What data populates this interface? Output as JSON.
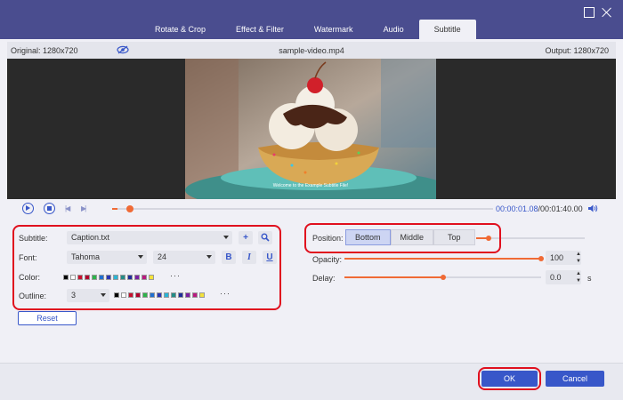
{
  "tabs": [
    {
      "label": "Rotate & Crop"
    },
    {
      "label": "Effect & Filter"
    },
    {
      "label": "Watermark"
    },
    {
      "label": "Audio"
    },
    {
      "label": "Subtitle"
    }
  ],
  "active_tab": "Subtitle",
  "info": {
    "original": "Original: 1280x720",
    "filename": "sample-video.mp4",
    "output": "Output: 1280x720"
  },
  "preview": {
    "subtitle_text": "Welcome to the Example Subtitle File!"
  },
  "playback": {
    "current_time": "00:00:01.08",
    "total_time": "/00:01:40.00",
    "progress": 0.015
  },
  "subtitle_form": {
    "subtitle_label": "Subtitle:",
    "subtitle_file": "Caption.txt",
    "font_label": "Font:",
    "font_name": "Tahoma",
    "font_size": "24",
    "bold": "B",
    "italic": "I",
    "underline": "U",
    "color_label": "Color:",
    "outline_label": "Outline:",
    "outline_value": "3",
    "more": "···",
    "reset": "Reset"
  },
  "palette": [
    "#000000",
    "#ffffff",
    "#c8102e",
    "#b3002d",
    "#2cb44a",
    "#1f6fd1",
    "#2a35b5",
    "#2ab5d6",
    "#238c87",
    "#1e2d99",
    "#7a1fa2",
    "#b81a80",
    "#f4e23a"
  ],
  "position": {
    "label": "Position:",
    "options": [
      "Bottom",
      "Middle",
      "Top"
    ],
    "selected": "Bottom"
  },
  "opacity": {
    "label": "Opacity:",
    "value": "100",
    "level": 1.0
  },
  "delay": {
    "label": "Delay:",
    "value": "0.0",
    "unit": "s",
    "level": 0.5
  },
  "footer": {
    "ok": "OK",
    "cancel": "Cancel"
  }
}
